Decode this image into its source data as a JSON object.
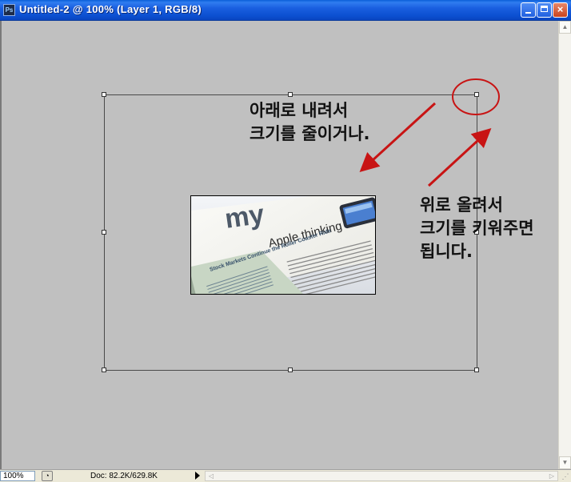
{
  "window": {
    "title": "Untitled-2 @ 100% (Layer 1, RGB/8)",
    "app_icon_text": "Ps",
    "icon": "photoshop-app-icon"
  },
  "controls": {
    "minimize": "minimize-icon",
    "maximize": "maximize-icon",
    "close_label": "×"
  },
  "status": {
    "zoom": "100%",
    "doc": "Doc: 82.2K/629.8K",
    "scroll_left": "◁",
    "scroll_right": "▷",
    "scroll_up": "▲",
    "scroll_down": "▼"
  },
  "annotations": {
    "shrink": "아래로 내려서\n크기를 줄이거나.",
    "enlarge": "위로 올려서\n크기를 키워주면\n됩니다."
  },
  "image": {
    "masthead": "my",
    "headline": "Apple thinking",
    "subhead": "Stock Markets Continue the Roller Coaster Ride"
  },
  "colors": {
    "canvas": "#c0c0c0",
    "title_bar": "#0a4fd0",
    "annotation_red": "#c81414"
  }
}
